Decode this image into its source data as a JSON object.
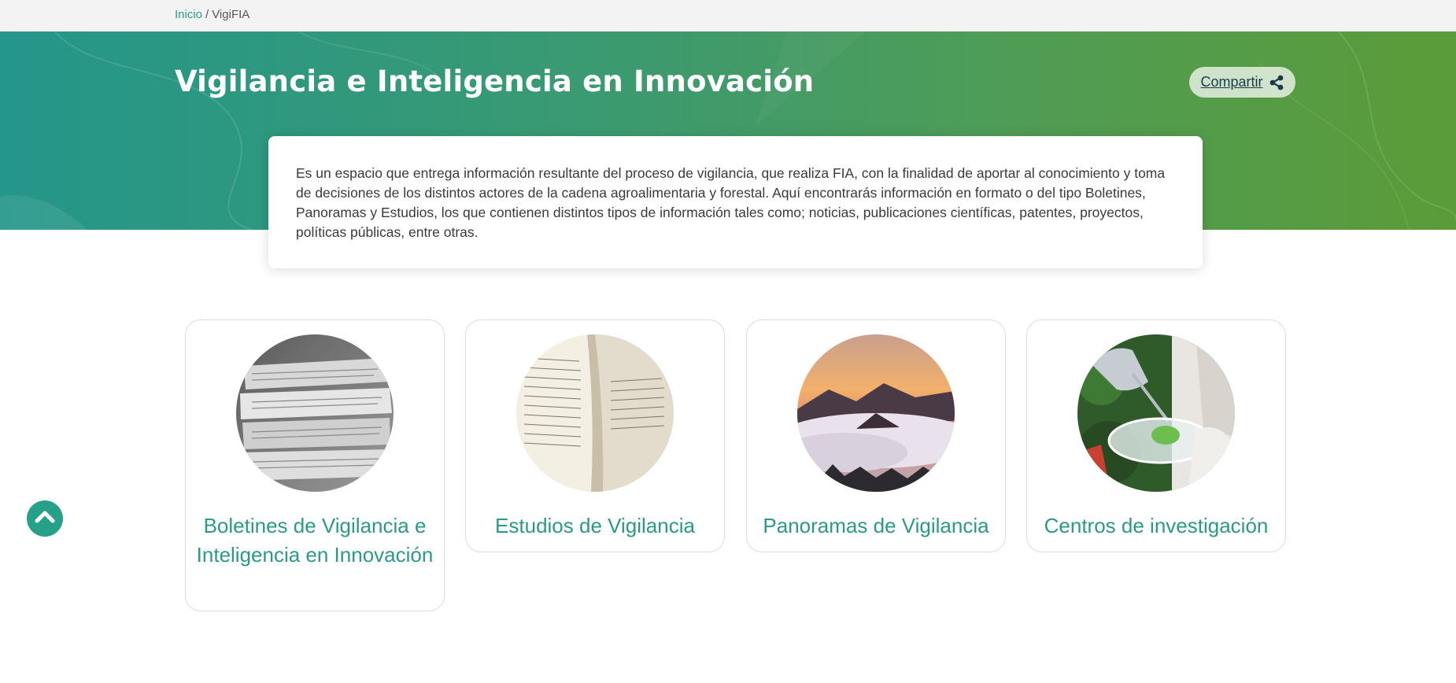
{
  "breadcrumb": {
    "home_label": "Inicio",
    "separator": "/",
    "current_label": "VigiFIA"
  },
  "header": {
    "title": "Vigilancia e Inteligencia en Innovación",
    "share_label": "Compartir",
    "share_icon": "share-icon"
  },
  "intro": {
    "text": "Es un espacio que entrega información resultante del proceso de vigilancia, que realiza FIA, con la finalidad de aportar al conocimiento y toma de decisiones de los distintos actores de la cadena agroalimentaria y forestal. Aquí encontrarás información en formato o del tipo Boletines, Panoramas y Estudios, los que contienen distintos tipos de información tales como; noticias, publicaciones científicas, patentes, proyectos, políticas públicas, entre otras."
  },
  "cards": [
    {
      "label": "Boletines de Vigilancia e Inteligencia en Innovación",
      "image": "newspapers-image"
    },
    {
      "label": "Estudios de Vigilancia",
      "image": "open-book-image"
    },
    {
      "label": "Panoramas de Vigilancia",
      "image": "mountain-landscape-image"
    },
    {
      "label": "Centros de investigación",
      "image": "lab-petri-dish-image"
    }
  ],
  "scroll_top": {
    "icon": "chevron-up-icon"
  },
  "colors": {
    "accent": "#2a9a86",
    "hero_start": "#24968a",
    "hero_end": "#5b9b38",
    "breadcrumb_bg": "#f3f3f3"
  }
}
